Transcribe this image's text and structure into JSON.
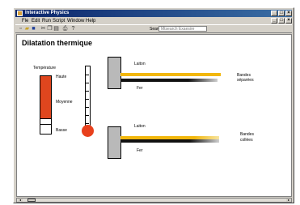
{
  "window": {
    "title": "Interactive Physics"
  },
  "menu": {
    "items": [
      "Fle",
      "Edit",
      "Run",
      "Script",
      "Window",
      "Help"
    ]
  },
  "toolbar": {
    "search_label": "Search",
    "search_placeholder": "Mtsearch Exaesire"
  },
  "content": {
    "title": "Dilatation thermique",
    "temperature_label": "Température",
    "levels": {
      "high": "Haute",
      "medium": "Moyenne",
      "low": "Basse"
    },
    "temperature_level": 0.75,
    "top_assembly": {
      "brass_label": "Laiton",
      "iron_label": "Fer",
      "caption": [
        "Bandes",
        "séparées"
      ]
    },
    "bottom_assembly": {
      "brass_label": "Laiton",
      "iron_label": "Fer",
      "caption": [
        "Bandes",
        "collées"
      ]
    }
  },
  "colors": {
    "brass": "#f2b70c",
    "iron": "#1a1a1a",
    "heat": "#e0461e",
    "clamp": "#b9b9b9"
  }
}
